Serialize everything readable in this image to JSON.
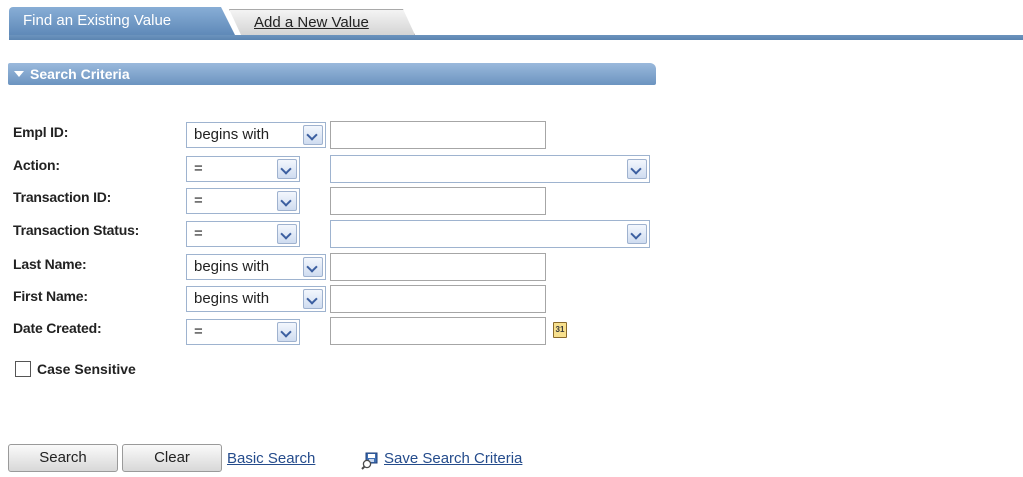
{
  "tabs": {
    "active_label": "Find an Existing Value",
    "inactive_label": "Add a New Value"
  },
  "section": {
    "title": "Search Criteria"
  },
  "fields": [
    {
      "label": "Empl ID:",
      "operator": "begins with",
      "value": ""
    },
    {
      "label": "Action:",
      "operator": "=",
      "value": ""
    },
    {
      "label": "Transaction ID:",
      "operator": "=",
      "value": ""
    },
    {
      "label": "Transaction Status:",
      "operator": "=",
      "value": ""
    },
    {
      "label": "Last Name:",
      "operator": "begins with",
      "value": ""
    },
    {
      "label": "First Name:",
      "operator": "begins with",
      "value": ""
    },
    {
      "label": "Date Created:",
      "operator": "=",
      "value": ""
    }
  ],
  "calendar_icon_text": "31",
  "case_sensitive": {
    "label": "Case Sensitive",
    "checked": false
  },
  "actions": {
    "search_label": "Search",
    "clear_label": "Clear",
    "basic_search_label": "Basic Search",
    "save_criteria_label": "Save Search Criteria"
  },
  "icons": {
    "dropdown": "chevron-down-icon",
    "calendar": "calendar-icon",
    "save": "save-search-icon",
    "section_toggle": "triangle-down-icon"
  },
  "colors": {
    "tab_active": "#6f97c4",
    "section_header": "#7fa3cc",
    "link": "#254c8c"
  }
}
